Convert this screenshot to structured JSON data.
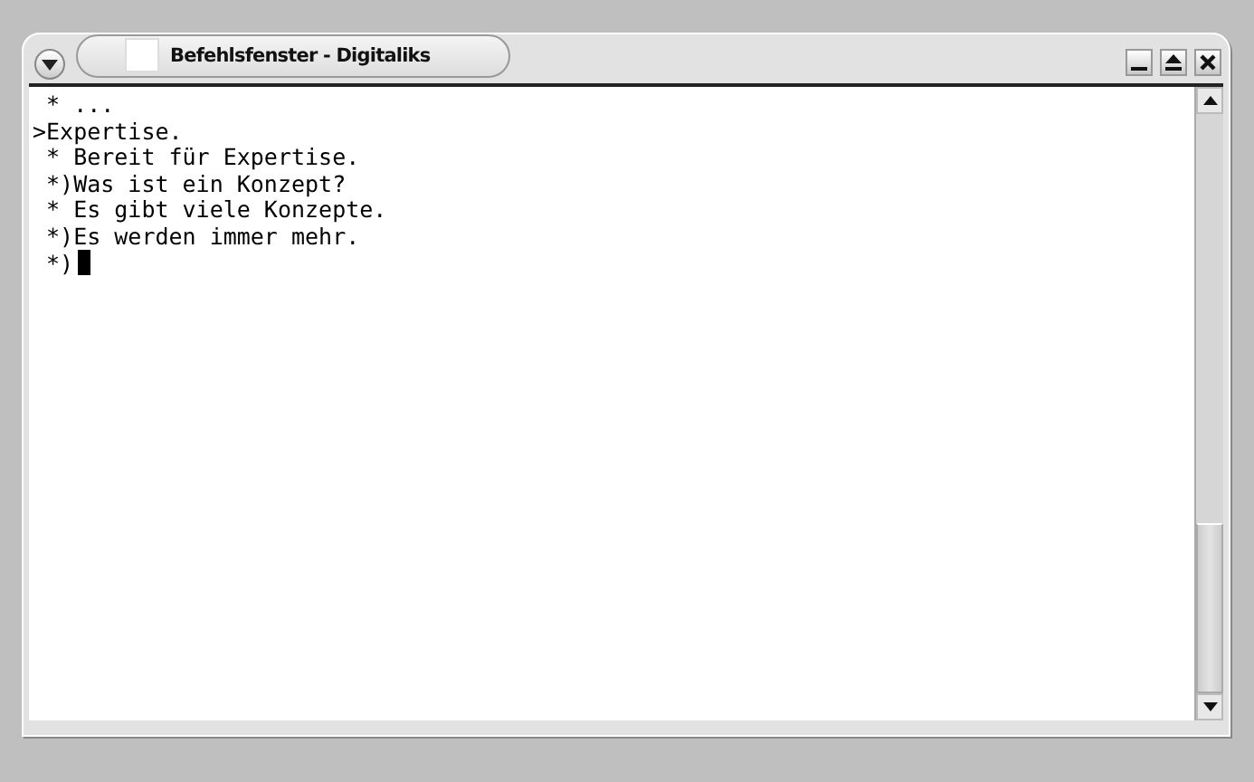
{
  "window": {
    "title": "Befehlsfenster - Digitaliks"
  },
  "terminal": {
    "lines": [
      " * ...",
      ">Expertise.",
      " * Bereit für Expertise.",
      " *)Was ist ein Konzept?",
      " * Es gibt viele Konzepte.",
      " *)Es werden immer mehr.",
      " *)"
    ]
  }
}
